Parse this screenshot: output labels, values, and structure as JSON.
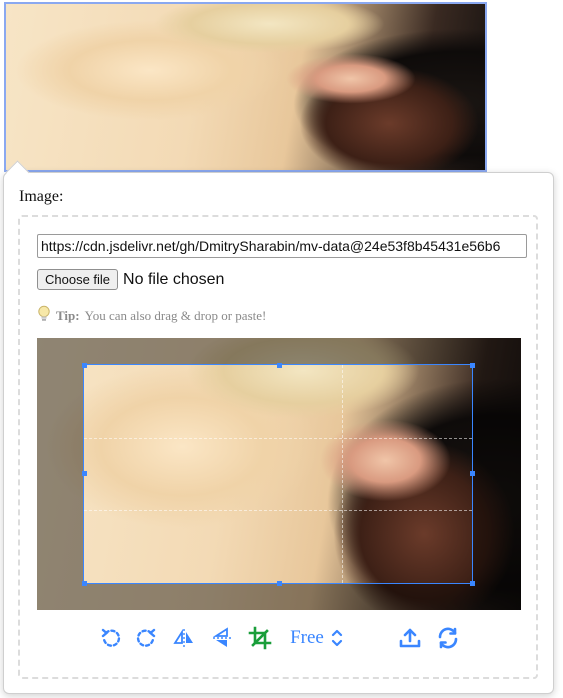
{
  "editor": {
    "image_label": "Image:",
    "url_value": "https://cdn.jsdelivr.net/gh/DmitrySharabin/mv-data@24e53f8b45431e56b6",
    "file_button_label": "Choose file",
    "file_status": "No file chosen",
    "tip_label": "Tip:",
    "tip_text": "You can also drag & drop or paste!"
  },
  "toolbar": {
    "ratio_label": "Free",
    "icons": [
      "rotate-left-icon",
      "rotate-right-icon",
      "flip-horizontal-icon",
      "flip-vertical-icon",
      "crop-icon",
      "chevron-updown-icon",
      "upload-icon",
      "reset-icon"
    ]
  },
  "colors": {
    "accent": "#3a86ff",
    "crop_icon": "#1a9e3a",
    "selection_border": "#8aa8f0"
  }
}
